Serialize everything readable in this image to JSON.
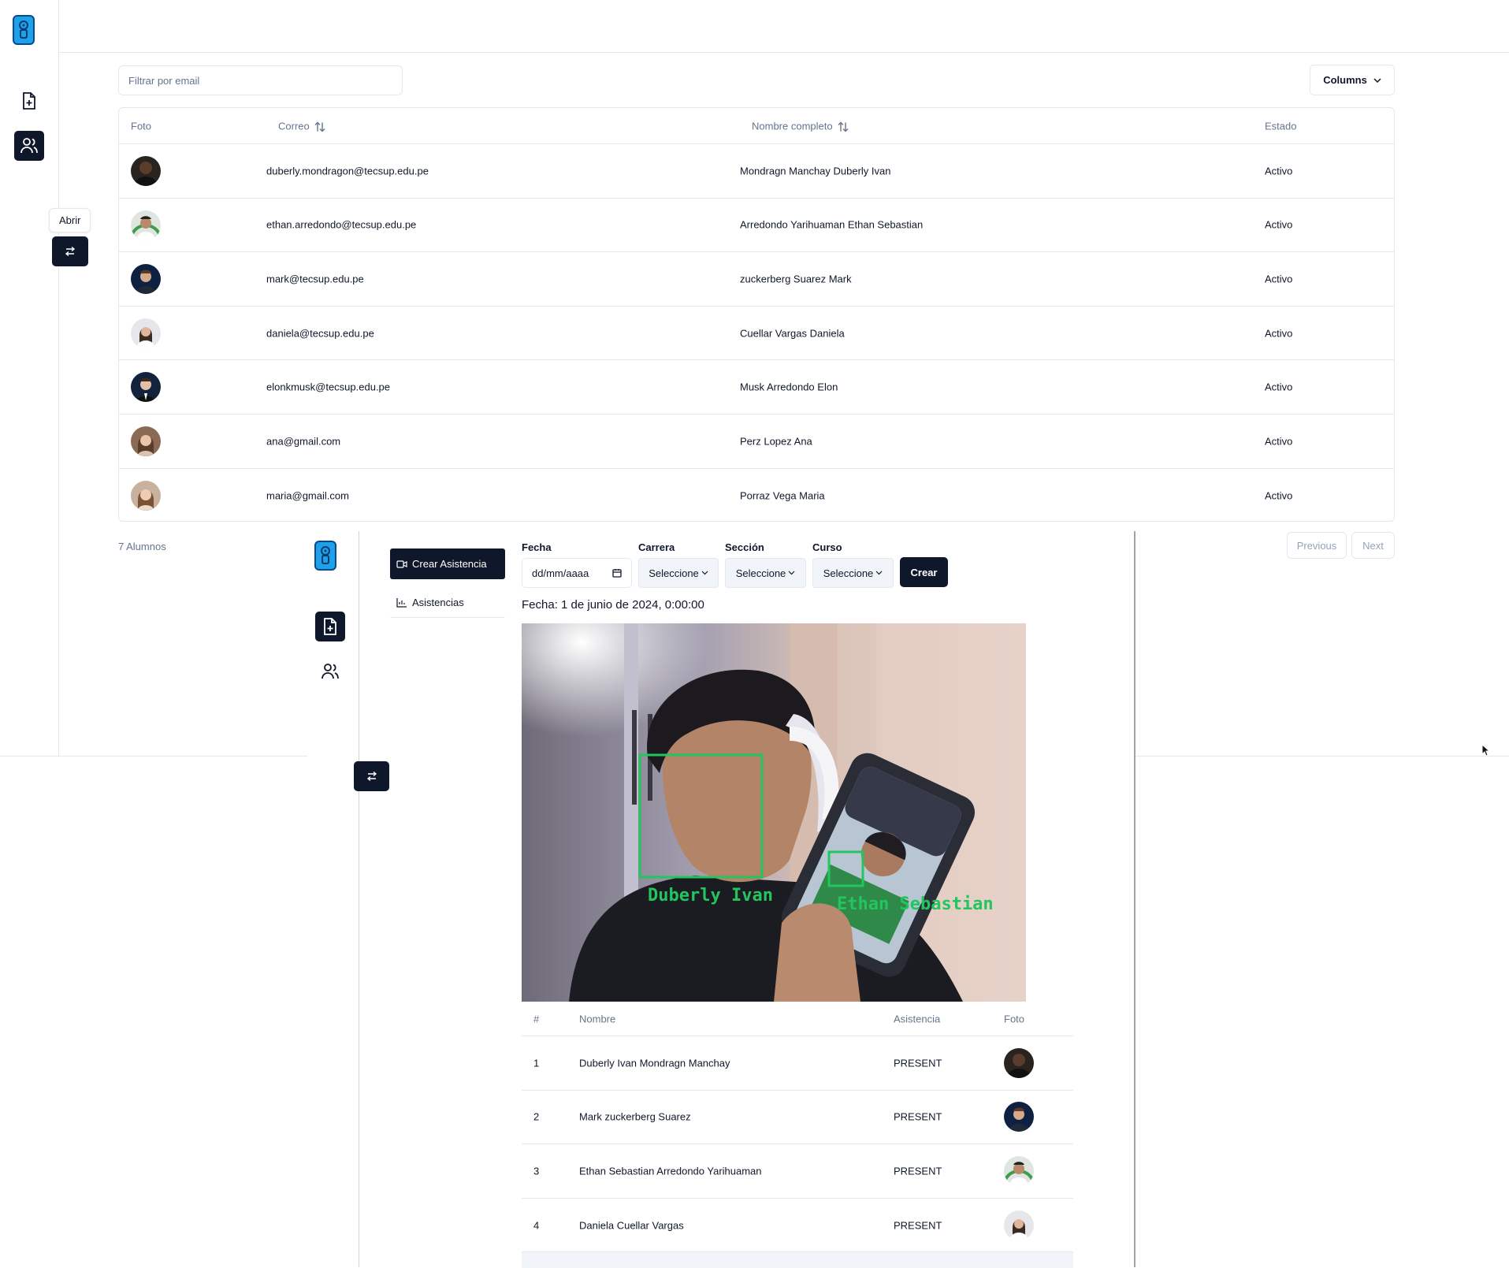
{
  "tooltip": "Abrir",
  "search": {
    "placeholder": "Filtrar por email"
  },
  "columns_button": "Columns",
  "users_table": {
    "headers": {
      "foto": "Foto",
      "correo": "Correo",
      "nombre": "Nombre completo",
      "estado": "Estado"
    },
    "rows": [
      {
        "email": "duberly.mondragon@tecsup.edu.pe",
        "name": "Mondragn Manchay Duberly Ivan",
        "status": "Activo"
      },
      {
        "email": "ethan.arredondo@tecsup.edu.pe",
        "name": "Arredondo Yarihuaman Ethan Sebastian",
        "status": "Activo"
      },
      {
        "email": "mark@tecsup.edu.pe",
        "name": "zuckerberg Suarez Mark",
        "status": "Activo"
      },
      {
        "email": "daniela@tecsup.edu.pe",
        "name": "Cuellar Vargas Daniela",
        "status": "Activo"
      },
      {
        "email": "elonkmusk@tecsup.edu.pe",
        "name": "Musk Arredondo Elon",
        "status": "Activo"
      },
      {
        "email": "ana@gmail.com",
        "name": "Perz Lopez Ana",
        "status": "Activo"
      },
      {
        "email": "maria@gmail.com",
        "name": "Porraz Vega Maria",
        "status": "Activo"
      }
    ]
  },
  "footer": {
    "count": "7 Alumnos",
    "previous": "Previous",
    "next": "Next"
  },
  "attendance": {
    "tabs": {
      "crear": "Crear Asistencia",
      "asistencias": "Asistencias"
    },
    "form": {
      "fecha_label": "Fecha",
      "fecha_value": "dd/mm/aaaa",
      "carrera_label": "Carrera",
      "carrera_value": "Seleccione",
      "seccion_label": "Sección",
      "seccion_value": "Seleccione",
      "curso_label": "Curso",
      "curso_value": "Seleccione",
      "crear": "Crear"
    },
    "fecha_text": "Fecha: 1 de junio de 2024, 0:00:00",
    "camera_labels": {
      "face1": "Duberly Ivan",
      "face2": "Ethan Sebastian"
    },
    "table": {
      "headers": {
        "num": "#",
        "nombre": "Nombre",
        "asistencia": "Asistencia",
        "foto": "Foto"
      },
      "rows": [
        {
          "num": "1",
          "name": "Duberly Ivan Mondragn Manchay",
          "status": "PRESENT"
        },
        {
          "num": "2",
          "name": "Mark zuckerberg Suarez",
          "status": "PRESENT"
        },
        {
          "num": "3",
          "name": "Ethan Sebastian Arredondo Yarihuaman",
          "status": "PRESENT"
        },
        {
          "num": "4",
          "name": "Daniela Cuellar Vargas",
          "status": "PRESENT"
        }
      ]
    }
  },
  "icons": [
    "logo-icon",
    "file-plus-icon",
    "users-icon",
    "toggle-arrows-icon",
    "chevron-down-icon",
    "sort-icon",
    "calendar-icon",
    "video-icon",
    "chart-icon",
    "cursor-icon"
  ],
  "colors": {
    "primary": "#0f172a",
    "border": "#e2e8f0",
    "muted": "#64748b",
    "logo": "#1da1e8",
    "face_box": "#22c55e"
  }
}
